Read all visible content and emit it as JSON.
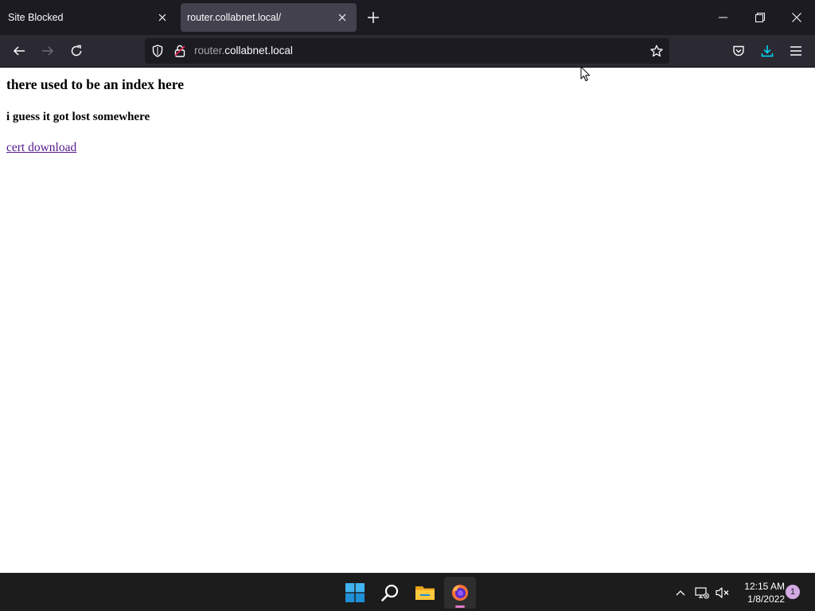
{
  "browser": {
    "tabs": [
      {
        "title": "Site Blocked",
        "active": false
      },
      {
        "title": "router.collabnet.local/",
        "active": true
      }
    ],
    "url": {
      "subdomain": "router.",
      "domain": "collabnet.local"
    },
    "accent_color": "#00ddff"
  },
  "page": {
    "heading": "there used to be an index here",
    "subheading": "i guess it got lost somewhere",
    "link_text": "cert download",
    "link_color": "#551a8b"
  },
  "taskbar": {
    "time": "12:15 AM",
    "date": "1/8/2022",
    "notification_count": "1",
    "apps": [
      "windows-start",
      "search",
      "file-explorer",
      "firefox"
    ]
  }
}
